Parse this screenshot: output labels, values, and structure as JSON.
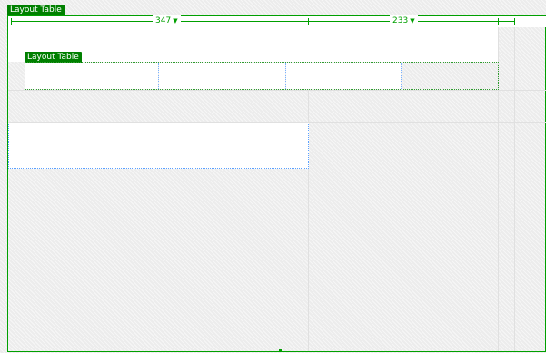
{
  "outer_table": {
    "label": "Layout Table",
    "column_widths": [
      {
        "label": "347"
      },
      {
        "label": "233"
      }
    ],
    "menu_arrow": "▼"
  },
  "inner_table": {
    "label": "Layout Table",
    "cells": [
      "",
      "",
      "",
      ""
    ]
  },
  "cells": {
    "top_content": "",
    "lower_left": ""
  },
  "colors": {
    "layout_green": "#008000",
    "outline_green": "#00a000",
    "cell_blue": "#5aa0ff",
    "empty_hatch": "#ececec"
  }
}
